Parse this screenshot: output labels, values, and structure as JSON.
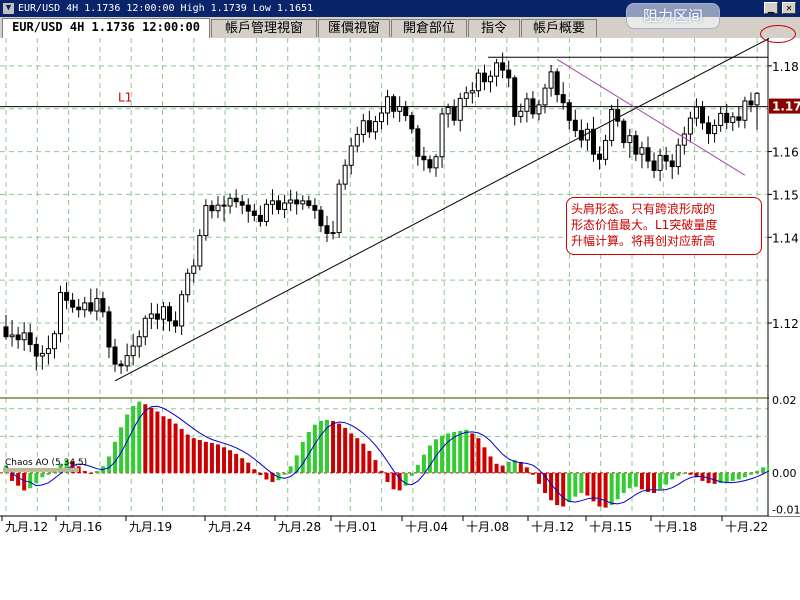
{
  "window": {
    "title": "EUR/USD 4H 1.1736 12:00:00 High 1.1739 Low 1.1651",
    "app_icon": "chart-app-icon",
    "controls": [
      "minimize-icon",
      "close-icon"
    ]
  },
  "tabs": [
    {
      "label": "EUR/USD 4H 1.1736 12:00:00",
      "active": true
    },
    {
      "label": "帳戶管理視窗",
      "active": false
    },
    {
      "label": "匯價視窗",
      "active": false
    },
    {
      "label": "開倉部位",
      "active": false
    },
    {
      "label": "指令",
      "active": false
    },
    {
      "label": "帳戶概要",
      "active": false
    }
  ],
  "annotation": {
    "line1": "头肩形态。只有跨浪形成的",
    "line2": "形态价值最大。L1突破量度",
    "line3": "升幅计算。将再创对应新高"
  },
  "resistance_label": "阻力区间",
  "colors": {
    "background": "#ffffff",
    "candle": "#000000",
    "grid": "#90c890",
    "ao_up": "#33cc33",
    "ao_down": "#cc0000",
    "ao_ma": "#0000cc",
    "trendline_down": "#aa44aa",
    "current_price_bg": "#880000",
    "annotation": "#cc0000"
  },
  "chart_data": {
    "type": "candlestick",
    "symbol": "EUR/USD",
    "timeframe": "4H",
    "last": 1.1736,
    "high": 1.1739,
    "low": 1.1651,
    "price_axis": {
      "range": [
        1.1025,
        1.1865
      ],
      "ticks": [
        "1.18",
        "1.16",
        "1.15",
        "1.14",
        "1.12"
      ],
      "tick_values": [
        1.18,
        1.16,
        1.15,
        1.14,
        1.12
      ],
      "current_price_label": "1.17",
      "current_price": 1.1705
    },
    "time_axis": {
      "labels": [
        "九月.12",
        "九月.16",
        "九月.19",
        "九月.24",
        "九月.28",
        "十月.01",
        "十月.04",
        "十月.08",
        "十月.12",
        "十月.15",
        "十月.18",
        "十月.22"
      ]
    },
    "horizontal_lines": [
      {
        "name": "L1",
        "value": 1.1705
      },
      {
        "name": "",
        "value": 1.182
      }
    ],
    "trendlines": [
      {
        "kind": "uptrend",
        "from": [
          18,
          1.1065
        ],
        "to": [
          127,
          1.1865
        ]
      },
      {
        "kind": "downtrend",
        "from": [
          91,
          1.1815
        ],
        "to": [
          122,
          1.1545
        ]
      }
    ],
    "candles_ohlc": [
      [
        1.1191,
        1.1219,
        1.1161,
        1.1168
      ],
      [
        1.1168,
        1.1207,
        1.1145,
        1.1172
      ],
      [
        1.1172,
        1.1191,
        1.114,
        1.1161
      ],
      [
        1.1161,
        1.1202,
        1.1135,
        1.1177
      ],
      [
        1.1177,
        1.1198,
        1.1132,
        1.115
      ],
      [
        1.115,
        1.1167,
        1.1089,
        1.1123
      ],
      [
        1.1123,
        1.1148,
        1.1091,
        1.1129
      ],
      [
        1.1129,
        1.1171,
        1.1103,
        1.114
      ],
      [
        1.114,
        1.1182,
        1.1117,
        1.1175
      ],
      [
        1.1175,
        1.1287,
        1.1155,
        1.1271
      ],
      [
        1.1271,
        1.1295,
        1.1232,
        1.1253
      ],
      [
        1.1253,
        1.127,
        1.1224,
        1.1237
      ],
      [
        1.1237,
        1.1256,
        1.1213,
        1.1231
      ],
      [
        1.1231,
        1.1261,
        1.1213,
        1.1247
      ],
      [
        1.1247,
        1.128,
        1.122,
        1.1228
      ],
      [
        1.1228,
        1.1281,
        1.1206,
        1.1257
      ],
      [
        1.1257,
        1.1273,
        1.1213,
        1.1226
      ],
      [
        1.1226,
        1.1239,
        1.1118,
        1.1144
      ],
      [
        1.1144,
        1.1163,
        1.1086,
        1.1104
      ],
      [
        1.1104,
        1.1113,
        1.1081,
        1.11
      ],
      [
        1.11,
        1.1152,
        1.1087,
        1.1124
      ],
      [
        1.1124,
        1.1175,
        1.1101,
        1.1146
      ],
      [
        1.1146,
        1.1183,
        1.1119,
        1.1168
      ],
      [
        1.1168,
        1.1218,
        1.1148,
        1.1211
      ],
      [
        1.1211,
        1.1247,
        1.1186,
        1.1221
      ],
      [
        1.1221,
        1.1245,
        1.1186,
        1.1209
      ],
      [
        1.1209,
        1.1249,
        1.1182,
        1.1238
      ],
      [
        1.1238,
        1.1249,
        1.1181,
        1.1205
      ],
      [
        1.1205,
        1.1227,
        1.1177,
        1.1193
      ],
      [
        1.1193,
        1.1276,
        1.1172,
        1.1266
      ],
      [
        1.1266,
        1.1327,
        1.1248,
        1.1316
      ],
      [
        1.1316,
        1.1349,
        1.1294,
        1.1333
      ],
      [
        1.1333,
        1.1419,
        1.1323,
        1.1404
      ],
      [
        1.1404,
        1.1489,
        1.1392,
        1.1474
      ],
      [
        1.1474,
        1.1486,
        1.1444,
        1.1462
      ],
      [
        1.1462,
        1.1496,
        1.1445,
        1.1475
      ],
      [
        1.1475,
        1.1497,
        1.1437,
        1.1473
      ],
      [
        1.1473,
        1.1502,
        1.1455,
        1.1491
      ],
      [
        1.1491,
        1.1512,
        1.1469,
        1.1483
      ],
      [
        1.1483,
        1.1499,
        1.1454,
        1.1475
      ],
      [
        1.1475,
        1.1491,
        1.1434,
        1.1461
      ],
      [
        1.1461,
        1.1478,
        1.1437,
        1.1451
      ],
      [
        1.1451,
        1.1474,
        1.1425,
        1.1437
      ],
      [
        1.1437,
        1.1489,
        1.1426,
        1.1477
      ],
      [
        1.1477,
        1.1512,
        1.1453,
        1.1485
      ],
      [
        1.1485,
        1.1498,
        1.1454,
        1.1465
      ],
      [
        1.1465,
        1.1499,
        1.1445,
        1.148
      ],
      [
        1.148,
        1.1511,
        1.1461,
        1.1487
      ],
      [
        1.1487,
        1.1507,
        1.1453,
        1.1478
      ],
      [
        1.1478,
        1.1498,
        1.1464,
        1.1485
      ],
      [
        1.1485,
        1.1497,
        1.1467,
        1.1474
      ],
      [
        1.1474,
        1.1491,
        1.1443,
        1.1463
      ],
      [
        1.1463,
        1.1473,
        1.1412,
        1.1427
      ],
      [
        1.1427,
        1.145,
        1.1389,
        1.1409
      ],
      [
        1.1409,
        1.1438,
        1.1395,
        1.1411
      ],
      [
        1.1411,
        1.1535,
        1.1398,
        1.1524
      ],
      [
        1.1524,
        1.1582,
        1.1511,
        1.1568
      ],
      [
        1.1568,
        1.1632,
        1.1547,
        1.1613
      ],
      [
        1.1613,
        1.1658,
        1.1598,
        1.164
      ],
      [
        1.164,
        1.1688,
        1.1621,
        1.1672
      ],
      [
        1.1672,
        1.1695,
        1.1632,
        1.1646
      ],
      [
        1.1646,
        1.1683,
        1.1628,
        1.167
      ],
      [
        1.167,
        1.1707,
        1.1652,
        1.169
      ],
      [
        1.169,
        1.1744,
        1.1662,
        1.1728
      ],
      [
        1.1728,
        1.1734,
        1.1678,
        1.1694
      ],
      [
        1.1694,
        1.1729,
        1.1669,
        1.1705
      ],
      [
        1.1705,
        1.1718,
        1.1671,
        1.1684
      ],
      [
        1.1684,
        1.1692,
        1.1642,
        1.1653
      ],
      [
        1.1653,
        1.1662,
        1.1567,
        1.1589
      ],
      [
        1.1589,
        1.1611,
        1.1555,
        1.1581
      ],
      [
        1.1581,
        1.1591,
        1.1551,
        1.1562
      ],
      [
        1.1562,
        1.1594,
        1.1541,
        1.1588
      ],
      [
        1.1588,
        1.1701,
        1.1562,
        1.1688
      ],
      [
        1.1688,
        1.1712,
        1.1656,
        1.1703
      ],
      [
        1.1703,
        1.1722,
        1.1661,
        1.1673
      ],
      [
        1.1673,
        1.1737,
        1.1647,
        1.1724
      ],
      [
        1.1724,
        1.1752,
        1.1706,
        1.1737
      ],
      [
        1.1737,
        1.1762,
        1.1712,
        1.1742
      ],
      [
        1.1742,
        1.1793,
        1.1727,
        1.1783
      ],
      [
        1.1783,
        1.1803,
        1.1743,
        1.1763
      ],
      [
        1.1763,
        1.1789,
        1.1738,
        1.1776
      ],
      [
        1.1776,
        1.1816,
        1.1752,
        1.1807
      ],
      [
        1.1807,
        1.1831,
        1.1771,
        1.179
      ],
      [
        1.179,
        1.1812,
        1.175,
        1.1772
      ],
      [
        1.1772,
        1.1778,
        1.1661,
        1.1682
      ],
      [
        1.1682,
        1.1712,
        1.1667,
        1.1694
      ],
      [
        1.1694,
        1.1737,
        1.1668,
        1.1723
      ],
      [
        1.1723,
        1.1741,
        1.1677,
        1.1688
      ],
      [
        1.1688,
        1.1721,
        1.1673,
        1.1709
      ],
      [
        1.1709,
        1.1758,
        1.1689,
        1.1748
      ],
      [
        1.1748,
        1.1802,
        1.1728,
        1.1786
      ],
      [
        1.1786,
        1.1794,
        1.1715,
        1.1733
      ],
      [
        1.1733,
        1.1762,
        1.1698,
        1.1714
      ],
      [
        1.1714,
        1.1722,
        1.1652,
        1.1673
      ],
      [
        1.1673,
        1.1698,
        1.1634,
        1.1649
      ],
      [
        1.1649,
        1.1675,
        1.1609,
        1.1627
      ],
      [
        1.1627,
        1.1667,
        1.1602,
        1.1652
      ],
      [
        1.1652,
        1.1681,
        1.1576,
        1.1594
      ],
      [
        1.1594,
        1.1612,
        1.1558,
        1.1582
      ],
      [
        1.1582,
        1.1639,
        1.1568,
        1.1626
      ],
      [
        1.1626,
        1.1709,
        1.1612,
        1.1698
      ],
      [
        1.1698,
        1.1723,
        1.1658,
        1.1671
      ],
      [
        1.1671,
        1.1677,
        1.1608,
        1.1621
      ],
      [
        1.1621,
        1.1653,
        1.1585,
        1.1637
      ],
      [
        1.1637,
        1.1649,
        1.1578,
        1.1594
      ],
      [
        1.1594,
        1.1623,
        1.1561,
        1.1609
      ],
      [
        1.1609,
        1.1635,
        1.1561,
        1.1578
      ],
      [
        1.1578,
        1.1598,
        1.1538,
        1.1556
      ],
      [
        1.1556,
        1.1607,
        1.1531,
        1.1591
      ],
      [
        1.1591,
        1.1611,
        1.1557,
        1.1578
      ],
      [
        1.1578,
        1.1594,
        1.1536,
        1.1565
      ],
      [
        1.1565,
        1.1631,
        1.1546,
        1.1615
      ],
      [
        1.1615,
        1.1658,
        1.1593,
        1.1641
      ],
      [
        1.1641,
        1.1693,
        1.1621,
        1.1678
      ],
      [
        1.1678,
        1.1724,
        1.1659,
        1.1704
      ],
      [
        1.1704,
        1.1718,
        1.1651,
        1.1667
      ],
      [
        1.1667,
        1.1683,
        1.1618,
        1.1642
      ],
      [
        1.1642,
        1.1675,
        1.1621,
        1.1661
      ],
      [
        1.1661,
        1.1705,
        1.1646,
        1.1689
      ],
      [
        1.1689,
        1.1711,
        1.1653,
        1.1668
      ],
      [
        1.1668,
        1.1692,
        1.1648,
        1.1681
      ],
      [
        1.1681,
        1.1704,
        1.1656,
        1.1673
      ],
      [
        1.1673,
        1.1728,
        1.1654,
        1.1718
      ],
      [
        1.1718,
        1.1738,
        1.1692,
        1.1709
      ],
      [
        1.1709,
        1.1739,
        1.1651,
        1.1736
      ]
    ],
    "indicator": {
      "name": "Chaos AO (5,34,5)",
      "range": [
        -0.0118,
        0.0205
      ],
      "ticks": [
        "0.02",
        "0.00",
        "-0.01"
      ],
      "tick_values": [
        0.02,
        0.0,
        -0.01
      ],
      "histogram": [
        0.002,
        -0.0022,
        -0.0035,
        -0.0048,
        -0.0042,
        -0.0028,
        -0.0012,
        -0.0005,
        0.0012,
        0.0025,
        0.0035,
        0.0032,
        0.0018,
        0.0005,
        -0.0002,
        0.0005,
        0.0018,
        0.0045,
        0.0085,
        0.0125,
        0.016,
        0.0183,
        0.0195,
        0.0188,
        0.0178,
        0.0168,
        0.0155,
        0.0148,
        0.0135,
        0.012,
        0.0105,
        0.0095,
        0.009,
        0.0085,
        0.0082,
        0.0078,
        0.007,
        0.0062,
        0.0052,
        0.004,
        0.0028,
        0.001,
        -0.0006,
        -0.0018,
        -0.0025,
        -0.002,
        -0.0005,
        0.0018,
        0.0048,
        0.0085,
        0.0112,
        0.0132,
        0.0142,
        0.0145,
        0.0142,
        0.0135,
        0.0123,
        0.0108,
        0.0095,
        0.008,
        0.006,
        0.0035,
        0.0005,
        -0.0025,
        -0.0045,
        -0.0048,
        -0.0035,
        -0.0008,
        0.0022,
        0.005,
        0.0075,
        0.0092,
        0.0102,
        0.0108,
        0.0112,
        0.0115,
        0.0118,
        0.0108,
        0.0095,
        0.007,
        0.0045,
        0.0025,
        0.002,
        0.003,
        0.0035,
        0.003,
        0.0015,
        -0.0005,
        -0.003,
        -0.0055,
        -0.0075,
        -0.0088,
        -0.0092,
        -0.008,
        -0.0065,
        -0.0055,
        -0.0062,
        -0.0078,
        -0.0092,
        -0.0095,
        -0.0088,
        -0.0072,
        -0.0055,
        -0.0042,
        -0.0038,
        -0.0045,
        -0.0052,
        -0.0055,
        -0.0045,
        -0.0032,
        -0.0018,
        -0.0008,
        -0.0003,
        -0.0005,
        -0.0012,
        -0.0022,
        -0.0028,
        -0.003,
        -0.0028,
        -0.0025,
        -0.0022,
        -0.0018,
        -0.0012,
        -0.0005,
        0.0005,
        0.0015,
        0.0025,
        0.0032
      ]
    },
    "grid": true
  }
}
